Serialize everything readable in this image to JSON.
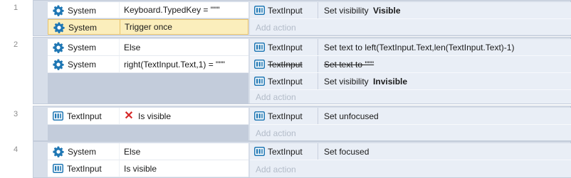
{
  "colors": {
    "accent": "#1f77b4",
    "selection": "#fbeebc",
    "invert_x": "#d62828"
  },
  "icons": {
    "system": "gear-icon",
    "textinput": "text-input-icon",
    "inverted": "x-icon"
  },
  "add_action_label": "Add action",
  "events": [
    {
      "number": "1",
      "conditions": [
        {
          "object": "System",
          "text": "Keyboard.TypedKey = \"\"\"",
          "selected": false
        },
        {
          "object": "System",
          "text": "Trigger once",
          "selected": true
        }
      ],
      "actions": [
        {
          "object": "TextInput",
          "prefix": "Set visibility ",
          "bold": "Visible"
        }
      ]
    },
    {
      "number": "2",
      "conditions": [
        {
          "object": "System",
          "text": "Else"
        },
        {
          "object": "System",
          "text": "right(TextInput.Text,1) = \"\"\""
        }
      ],
      "actions": [
        {
          "object": "TextInput",
          "text": "Set text to left(TextInput.Text,len(TextInput.Text)-1)"
        },
        {
          "object": "TextInput",
          "text": "Set text to \"\"\"",
          "disabled": true
        },
        {
          "object": "TextInput",
          "prefix": "Set visibility ",
          "bold": "Invisible"
        }
      ]
    },
    {
      "number": "3",
      "conditions": [
        {
          "object": "TextInput",
          "text": "Is visible",
          "inverted": true
        }
      ],
      "actions": [
        {
          "object": "TextInput",
          "text": "Set unfocused"
        }
      ]
    },
    {
      "number": "4",
      "conditions": [
        {
          "object": "System",
          "text": "Else"
        },
        {
          "object": "TextInput",
          "text": "Is visible"
        }
      ],
      "actions": [
        {
          "object": "TextInput",
          "text": "Set focused"
        }
      ]
    }
  ]
}
